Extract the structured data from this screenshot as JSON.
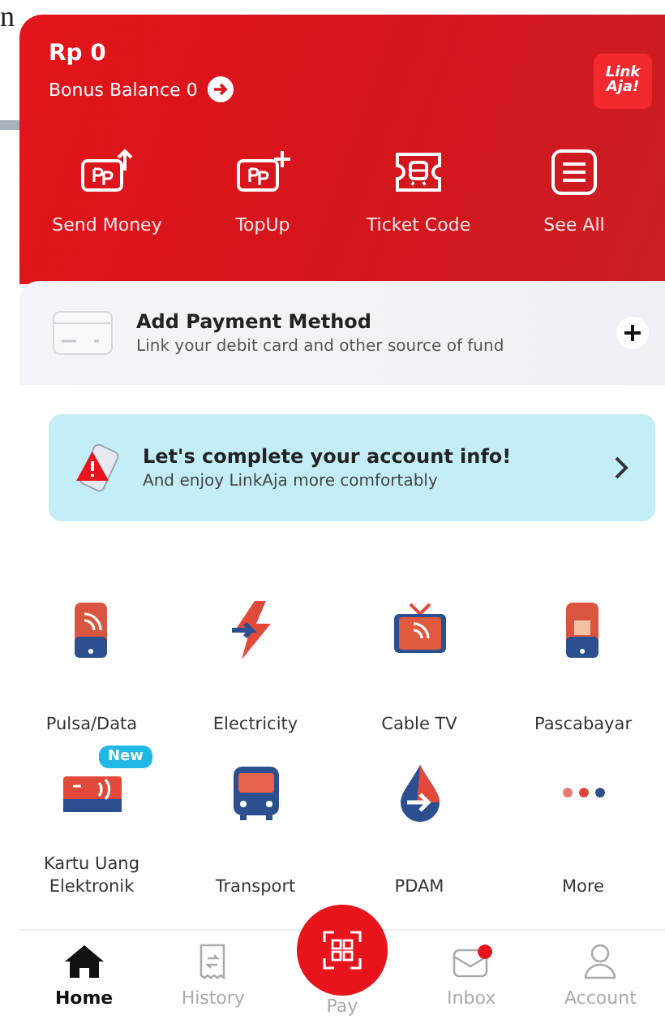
{
  "backdrop": {
    "text": "n"
  },
  "header": {
    "balance": "Rp 0",
    "bonus": "Bonus Balance 0",
    "logo": [
      "Link",
      "Aja!"
    ]
  },
  "quick_actions": [
    {
      "kind": "send",
      "label": "Send Money"
    },
    {
      "kind": "topup",
      "label": "TopUp"
    },
    {
      "kind": "ticket",
      "label": "Ticket Code"
    },
    {
      "kind": "all",
      "label": "See All"
    }
  ],
  "payment": {
    "title": "Add Payment Method",
    "subtitle": "Link your debit card and other source of fund"
  },
  "banner": {
    "title": "Let's complete your account info!",
    "subtitle": "And enjoy LinkAja more comfortably"
  },
  "services": [
    {
      "kind": "phone",
      "label": "Pulsa/Data"
    },
    {
      "kind": "bolt",
      "label": "Electricity"
    },
    {
      "kind": "tv",
      "label": "Cable TV"
    },
    {
      "kind": "postpaid",
      "label": "Pascabayar"
    },
    {
      "kind": "card",
      "label": "Kartu Uang Elektronik",
      "badge": "New"
    },
    {
      "kind": "bus",
      "label": "Transport"
    },
    {
      "kind": "drop",
      "label": "PDAM"
    },
    {
      "kind": "more",
      "label": "More"
    }
  ],
  "nav": [
    {
      "kind": "home",
      "label": "Home",
      "selected": true
    },
    {
      "kind": "history",
      "label": "History",
      "selected": false
    },
    {
      "kind": "pay",
      "label": "Pay",
      "selected": false
    },
    {
      "kind": "inbox",
      "label": "Inbox",
      "selected": false,
      "unread": true
    },
    {
      "kind": "account",
      "label": "Account",
      "selected": false
    }
  ]
}
